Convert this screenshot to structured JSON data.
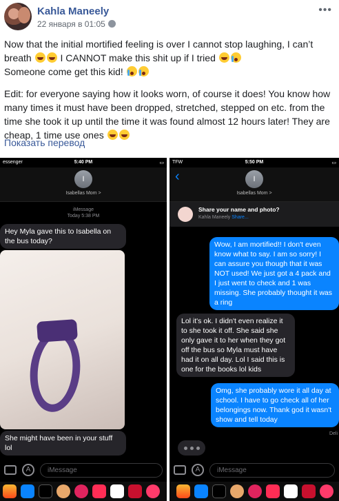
{
  "post": {
    "author": "Kahla Maneely",
    "timestamp": "22 января в 01:05",
    "line1": "Now that the initial mortified feeling is over I cannot stop laughing, I can’t",
    "line2a": "breath",
    "line2b": "I CANNOT make this shit up if I tried",
    "line3": "Someone come get this kid!",
    "edit": "Edit: for everyone saying how it looks worn, of course it does! You know how many times it must have been dropped, stretched, stepped on etc. from the time she took it up until the time it was found almost 12 hours later! They are cheap, 1 time use ones",
    "translate_link": "Показать перевод"
  },
  "left_screen": {
    "status_left": "essenger",
    "time": "5:40 PM",
    "contact_initial": "I",
    "contact_name": "Isabellas Mom >",
    "label_line1": "iMessage",
    "label_line2": "Today 5:38 PM",
    "msg1": "Hey Myla gave this to Isabella on the bus today?",
    "msg2": "She might have been in your stuff lol",
    "input_placeholder": "iMessage"
  },
  "right_screen": {
    "status_left": "TFW",
    "time": "5:50 PM",
    "contact_initial": "I",
    "contact_name": "Isabellas Mom >",
    "share_title": "Share your name and photo?",
    "share_sub_name": "Kahla Maneely",
    "share_sub_link": "Share...",
    "msg1": "Wow, I am mortified!! I don't even know what to say. I am so sorry! I can assure you though that it was NOT used! We just got a 4 pack and I just went to check and 1 was missing. She probably thought it was a ring",
    "msg2": "Lol it's ok. I didn't even realize it to she took it off. She said she only gave it to her when they got off the bus so Myla must have had it on all day. Lol I said this is one for the books lol kids",
    "msg3": "Omg, she probably wore it all day at school. I have to go check all of her belongings now. Thank god it wasn't show and tell today",
    "delivered": "Deli",
    "input_placeholder": "iMessage"
  }
}
